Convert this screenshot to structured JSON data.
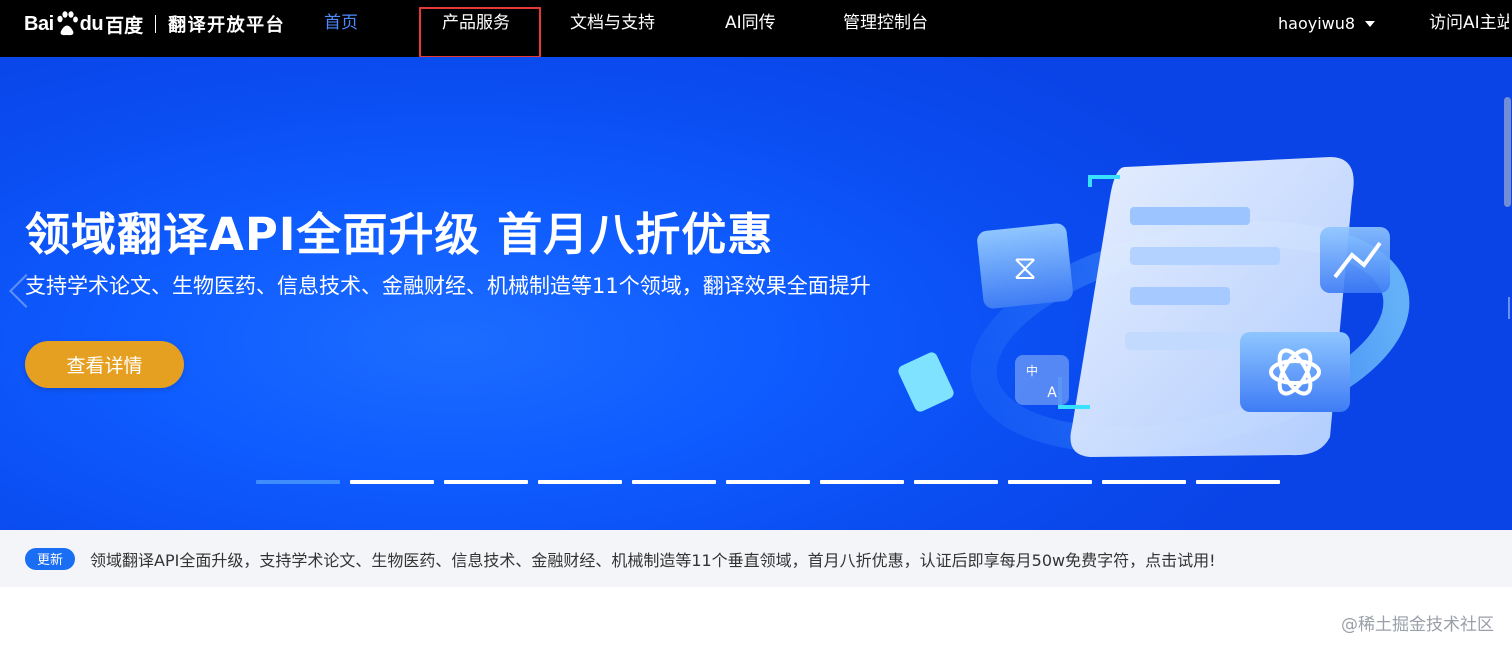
{
  "brand": {
    "logo_bai": "Bai",
    "logo_du": "du",
    "logo_cn": "百度",
    "platform": "翻译开放平台"
  },
  "nav": {
    "items": [
      {
        "label": "首页",
        "active": true
      },
      {
        "label": "产品服务",
        "active": false
      },
      {
        "label": "文档与支持",
        "active": false
      },
      {
        "label": "AI同传",
        "active": false
      },
      {
        "label": "管理控制台",
        "active": false
      }
    ],
    "username": "haoyiwu8",
    "visit_ai": "访问AI主站"
  },
  "hero": {
    "title": "领域翻译API全面升级 首月八折优惠",
    "subtitle": "支持学术论文、生物医药、信息技术、金融财经、机械制造等11个领域，翻译效果全面提升",
    "button": "查看详情",
    "carousel_count": 11,
    "carousel_active_index": 0,
    "art_labels": {
      "zh": "中",
      "en": "A"
    }
  },
  "notice": {
    "badge": "更新",
    "text": "领域翻译API全面升级，支持学术论文、生物医药、信息技术、金融财经、机械制造等11个垂直领域，首月八折优惠，认证后即享每月50w免费字符，点击试用!"
  },
  "watermark": "@稀土掘金技术社区",
  "colors": {
    "nav_bg": "#000000",
    "nav_active": "#4e8bff",
    "hero_blue": "#0f5cff",
    "button_orange": "#e6a021",
    "badge_blue": "#1a6ef3",
    "highlight_red": "#e53935"
  }
}
